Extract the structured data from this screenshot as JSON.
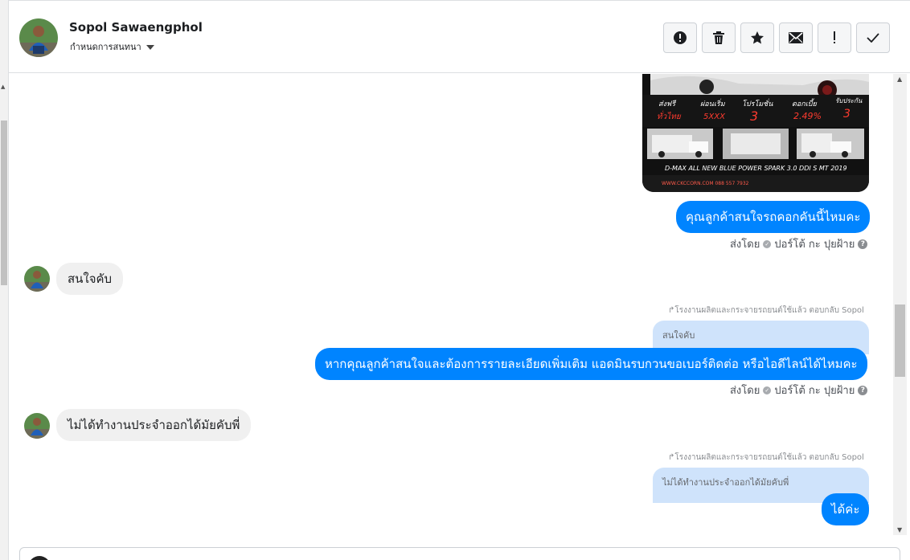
{
  "header": {
    "name": "Sopol Sawaengphol",
    "subtitle": "กำหนดการสนทนา",
    "tools": [
      {
        "name": "report-icon",
        "label": "รายงาน"
      },
      {
        "name": "trash-icon",
        "label": "ลบ"
      },
      {
        "name": "star-icon",
        "label": "ติดดาว"
      },
      {
        "name": "mail-icon",
        "label": "ทำเครื่องหมายว่ายังไม่อ่าน"
      },
      {
        "name": "exclamation-icon",
        "label": "สแปม"
      },
      {
        "name": "check-icon",
        "label": "เสร็จสิ้น"
      }
    ]
  },
  "image_ad": {
    "features": [
      "ส่งฟรี",
      "ผ่อนเริ่ม",
      "โปรโมชั่น",
      "ดอกเบี้ย",
      "รับประกัน"
    ],
    "feature_values": [
      "ทั่วไทย",
      "5XXX",
      "3",
      "2.49%",
      "3"
    ],
    "model_text": "D-MAX ALL NEW BLUE POWER SPARK 3.0 DDI S MT 2019",
    "contact_text": "WWW.CKCCORN.COM 088 557 7932"
  },
  "messages": {
    "m1": "คุณลูกค้าสนใจรถคอกคันนี้ไหมคะ",
    "m2": "สนใจคับ",
    "m3_reply_note": "↱โรงงานผลิตและกระจายรถยนต์ใช้แล้ว ตอบกลับ Sopol",
    "m3_quote": "สนใจคับ",
    "m3": "หากคุณลูกค้าสนใจและต้องการรายละเอียดเพิ่มเติม แอดมินรบกวนขอเบอร์ติดต่อ หรือไอดีไลน์ได้ไหมคะ",
    "m4": "ไม่ได้ทำงานประจำออกได้มัยคับพี่",
    "m5_reply_note": "↱โรงงานผลิตและกระจายรถยนต์ใช้แล้ว ตอบกลับ Sopol",
    "m5_quote": "ไม่ได้ทำงานประจำออกได้มัยคับพี่",
    "m5": "ได้ค่ะ"
  },
  "sent_by": {
    "prefix": "ส่งโดย",
    "agent": "ปอร์โต้ กะ ปุยฝ้าย"
  },
  "colors": {
    "brand_blue": "#0084ff",
    "quote_bg": "#cfe3fb",
    "incoming_bg": "#f0f0f0"
  }
}
